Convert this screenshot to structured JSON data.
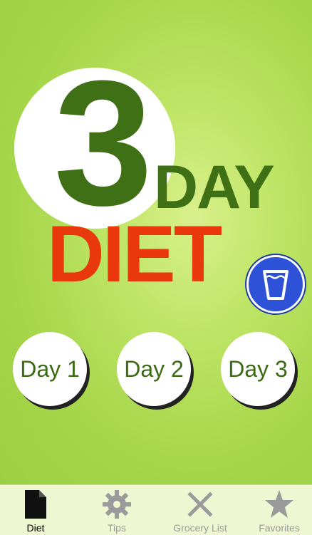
{
  "logo": {
    "number": "3",
    "word1": "DAY",
    "word2": "DIET",
    "colors": {
      "green": "#3f7016",
      "red": "#e8380c"
    }
  },
  "water_button": {
    "icon": "water-glass-icon",
    "color": "#2d52d8"
  },
  "days": [
    {
      "label": "Day 1"
    },
    {
      "label": "Day 2"
    },
    {
      "label": "Day 3"
    }
  ],
  "tabbar": {
    "active": "Diet",
    "items": [
      {
        "label": "Diet",
        "icon": "document-icon"
      },
      {
        "label": "Tips",
        "icon": "gear-icon"
      },
      {
        "label": "Grocery List",
        "icon": "x-icon"
      },
      {
        "label": "Favorites",
        "icon": "star-icon"
      }
    ]
  }
}
